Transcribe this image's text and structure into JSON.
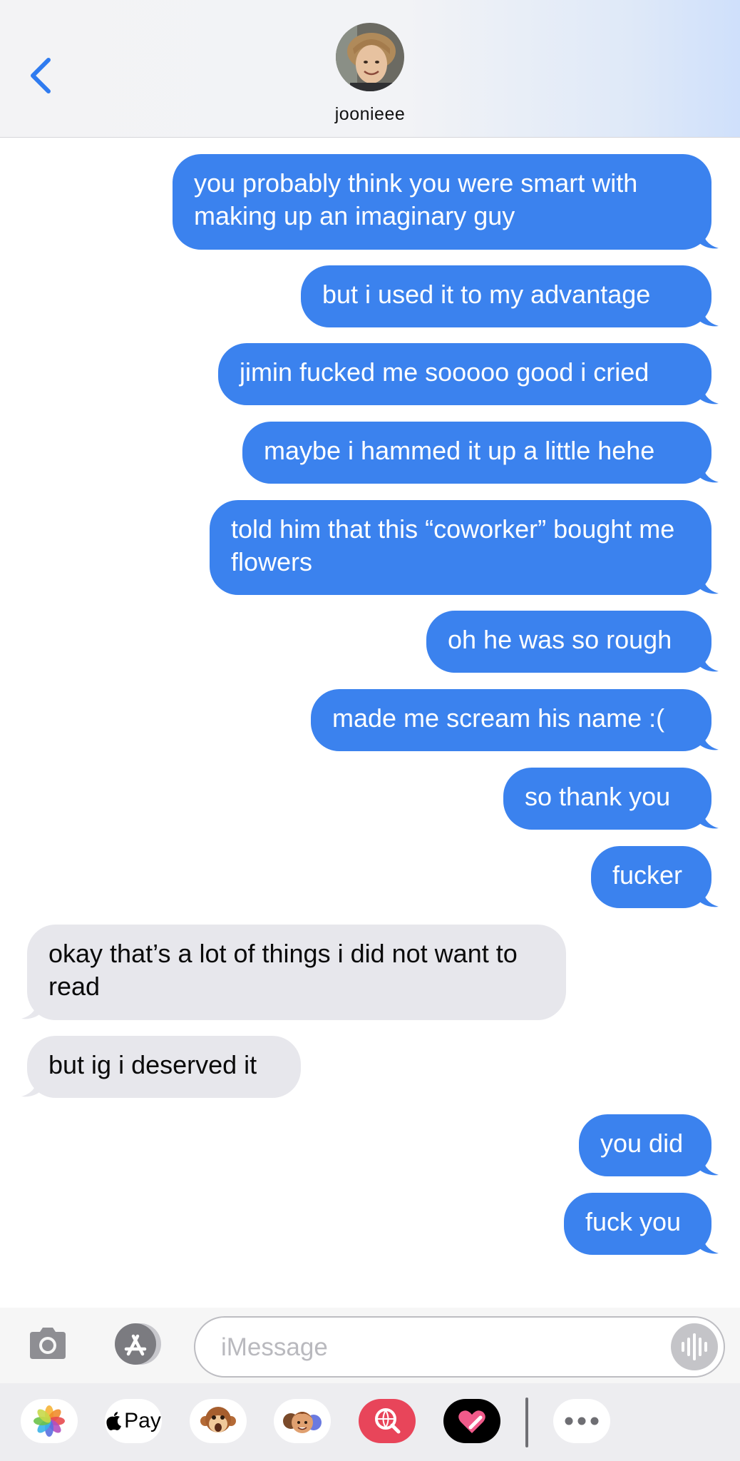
{
  "header": {
    "contact_name": "joonieee"
  },
  "messages": [
    {
      "direction": "outgoing",
      "text": "you probably think you were smart with making up an imaginary guy"
    },
    {
      "direction": "outgoing",
      "text": "but i used it to my advantage"
    },
    {
      "direction": "outgoing",
      "text": "jimin fucked me sooooo good i cried"
    },
    {
      "direction": "outgoing",
      "text": "maybe i hammed it up a little hehe"
    },
    {
      "direction": "outgoing",
      "text": "told him that this “coworker” bought me flowers"
    },
    {
      "direction": "outgoing",
      "text": "oh he was so rough"
    },
    {
      "direction": "outgoing",
      "text": "made me scream his name :("
    },
    {
      "direction": "outgoing",
      "text": "so thank you"
    },
    {
      "direction": "outgoing",
      "text": "fucker"
    },
    {
      "direction": "incoming",
      "text": "okay that’s a lot of things i did not want to read"
    },
    {
      "direction": "incoming",
      "text": "but ig i deserved it"
    },
    {
      "direction": "outgoing",
      "text": "you did"
    },
    {
      "direction": "outgoing",
      "text": "fuck you"
    }
  ],
  "composer": {
    "placeholder": "iMessage"
  },
  "app_drawer": {
    "apple_pay_label": "Pay",
    "apps": [
      "photos-icon",
      "apple-pay-icon",
      "animoji-icon",
      "memoji-icon",
      "image-search-icon",
      "digital-touch-icon",
      "more-icon"
    ]
  },
  "colors": {
    "outgoing_bubble": "#3b82ee",
    "incoming_bubble": "#e7e7ec",
    "accent": "#2f7bf0"
  }
}
